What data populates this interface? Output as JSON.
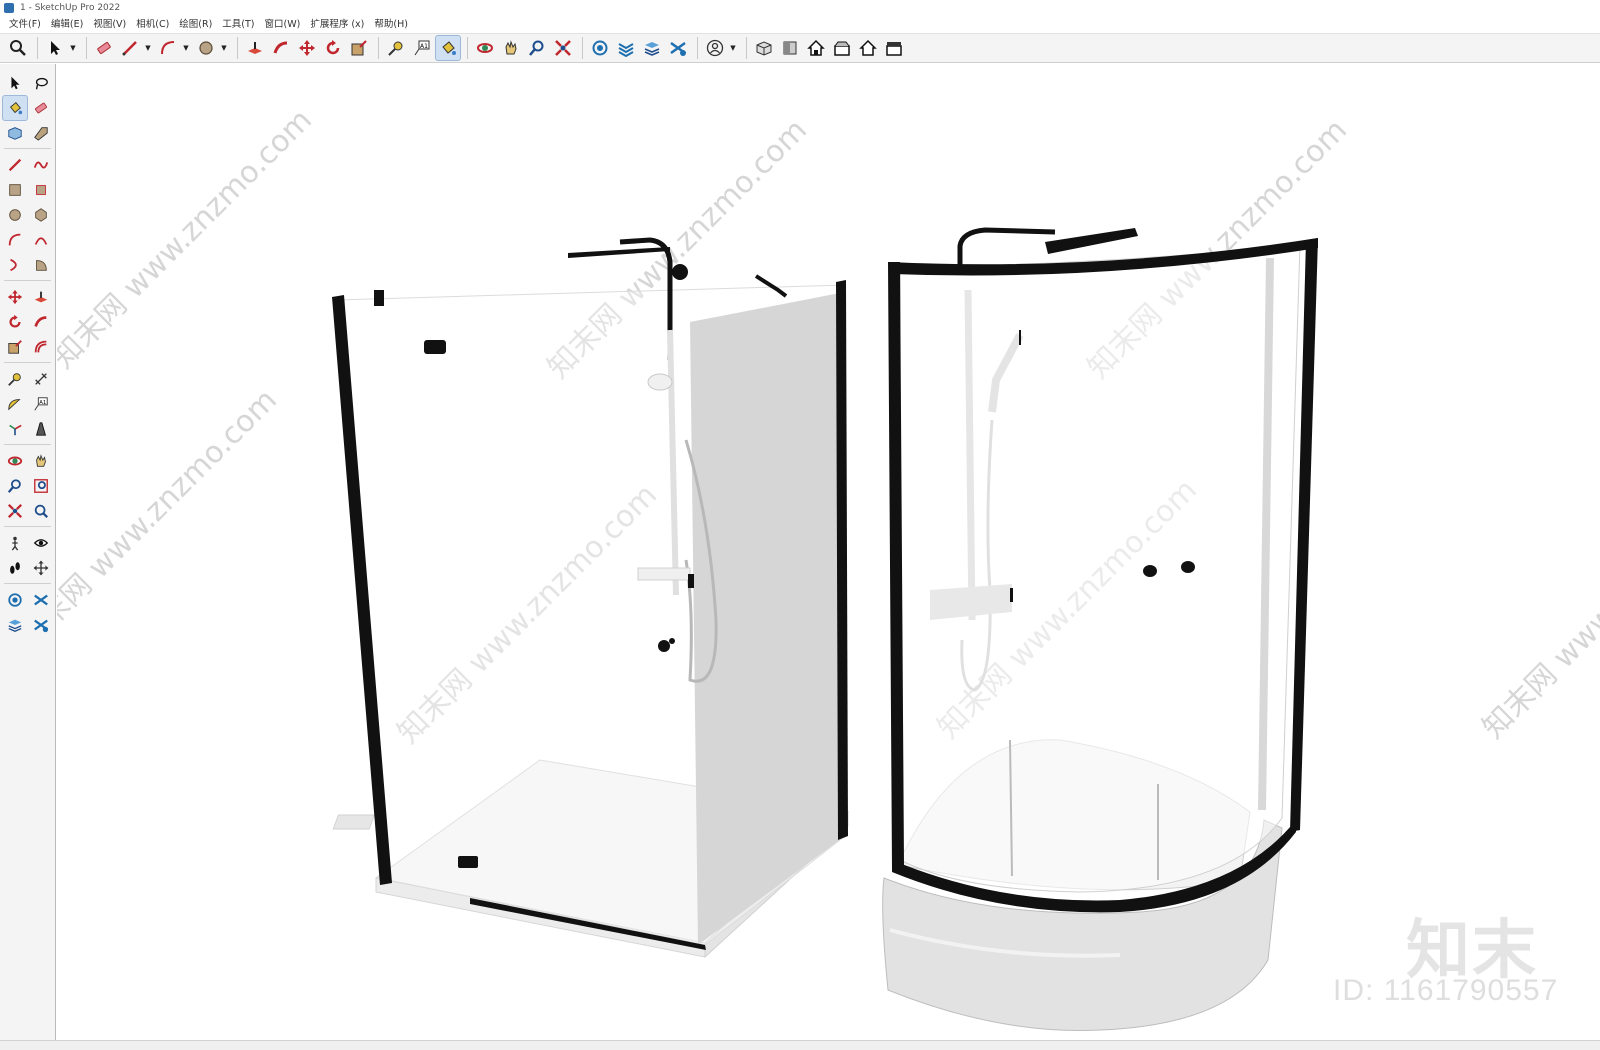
{
  "window": {
    "title": "1 - SketchUp Pro 2022"
  },
  "menu": [
    {
      "label": "文件(F)"
    },
    {
      "label": "编辑(E)"
    },
    {
      "label": "视图(V)"
    },
    {
      "label": "相机(C)"
    },
    {
      "label": "绘图(R)"
    },
    {
      "label": "工具(T)"
    },
    {
      "label": "窗口(W)"
    },
    {
      "label": "扩展程序 (x)"
    },
    {
      "label": "帮助(H)"
    }
  ],
  "toolbar_icons": [
    "zoom-icon",
    "select-icon",
    "eraser-icon",
    "line-icon",
    "arc-icon",
    "circle-icon",
    "push-pull-icon",
    "follow-me-icon",
    "move-icon",
    "rotate-icon",
    "scale-icon",
    "tape-measure-icon",
    "text-icon",
    "paint-bucket-icon",
    "orbit-icon",
    "pan-icon",
    "zoom-window-icon",
    "zoom-extents-icon",
    "warehouse-icon",
    "extension-icon",
    "layers-icon",
    "styles-icon",
    "profile-icon",
    "iso-view-icon",
    "top-view-icon",
    "front-view-icon",
    "right-view-icon",
    "back-view-icon",
    "left-view-icon"
  ],
  "colors": {
    "frame": "#111111",
    "glass_edge": "#c9c9c9",
    "panel_gray": "#c2c2c2",
    "tray": "#f2f2f2",
    "base": "#e0e0e0",
    "active_tool": "#cfe0f2"
  },
  "watermark": {
    "site": "知末网 www.znzmo.com",
    "brand": "知末",
    "id": "ID: 1161790557"
  }
}
